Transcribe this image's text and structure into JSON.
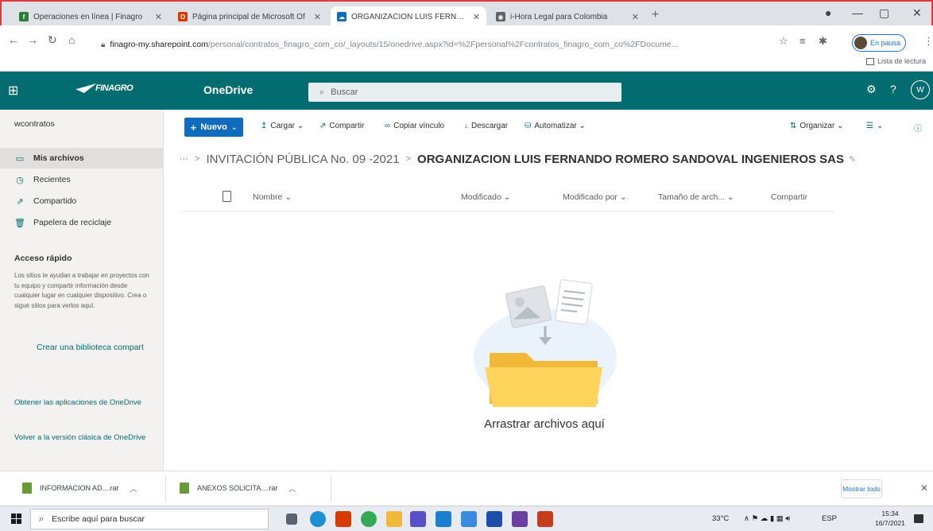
{
  "browser": {
    "tabs": [
      {
        "label": "Operaciones en línea | Finagro",
        "icon": "finagro-icon",
        "color": "#2a7d3a"
      },
      {
        "label": "Página principal de Microsoft Of",
        "icon": "office-icon",
        "color": "#d83b01"
      },
      {
        "label": "ORGANIZACION LUIS FERNANDO",
        "icon": "onedrive-icon",
        "color": "#0f6cbd"
      },
      {
        "label": "i-Hora Legal para Colombia",
        "icon": "globe-icon",
        "color": "#5f6368"
      }
    ],
    "new_tab": "+",
    "url_host": "finagro-my.sharepoint.com",
    "url_path": "/personal/contratos_finagro_com_co/_layouts/15/onedrive.aspx?id=%2Fpersonal%2Fcontratos_finagro_com_co%2FDocume...",
    "profile_label": "En pausa",
    "reading_list": "Lista de lectura"
  },
  "suite": {
    "logo_text": "FINAGRO",
    "app_name": "OneDrive",
    "search_placeholder": "Buscar",
    "avatar_initial": "W",
    "help": "?"
  },
  "leftnav": {
    "account": "wcontratos",
    "items": [
      {
        "label": "Mis archivos",
        "icon": "folder-icon"
      },
      {
        "label": "Recientes",
        "icon": "clock-icon"
      },
      {
        "label": "Compartido",
        "icon": "share-icon"
      },
      {
        "label": "Papelera de reciclaje",
        "icon": "trash-icon"
      }
    ],
    "quick_access_title": "Acceso rápido",
    "quick_access_text": "Los sitios te ayudan a trabajar en proyectos con tu equipo y compartir información desde cualquier lugar en cualquier dispositivo. Crea o sigue sitios para verlos aquí.",
    "create_library": "Crear una biblioteca compart",
    "get_apps": "Obtener las aplicaciones de OneDrive",
    "classic": "Volver a la versión clásica de OneDrive"
  },
  "commands": {
    "new": "Nuevo",
    "upload": "Cargar",
    "share": "Compartir",
    "copy_link": "Copiar vínculo",
    "download": "Descargar",
    "automate": "Automatizar",
    "organize": "Organizar"
  },
  "breadcrumb": {
    "ellipsis": "···",
    "parent": "INVITACIÓN PÚBLICA No. 09 -2021",
    "current": "ORGANIZACION LUIS FERNANDO ROMERO SANDOVAL INGENIEROS SAS"
  },
  "columns": {
    "name": "Nombre",
    "modified": "Modificado",
    "modified_by": "Modificado por",
    "size": "Tamaño de arch...",
    "sharing": "Compartir"
  },
  "empty_state": {
    "text": "Arrastrar archivos aquí"
  },
  "downloads": {
    "items": [
      {
        "label": "INFORMACION AD....rar"
      },
      {
        "label": "ANEXOS SOLICITA....rar"
      }
    ],
    "show_all": "Mostrar todo"
  },
  "taskbar": {
    "search_placeholder": "Escribe aquí para buscar",
    "temperature": "33°C",
    "lang": "ESP",
    "time": "15:34",
    "date": "16/7/2021"
  }
}
